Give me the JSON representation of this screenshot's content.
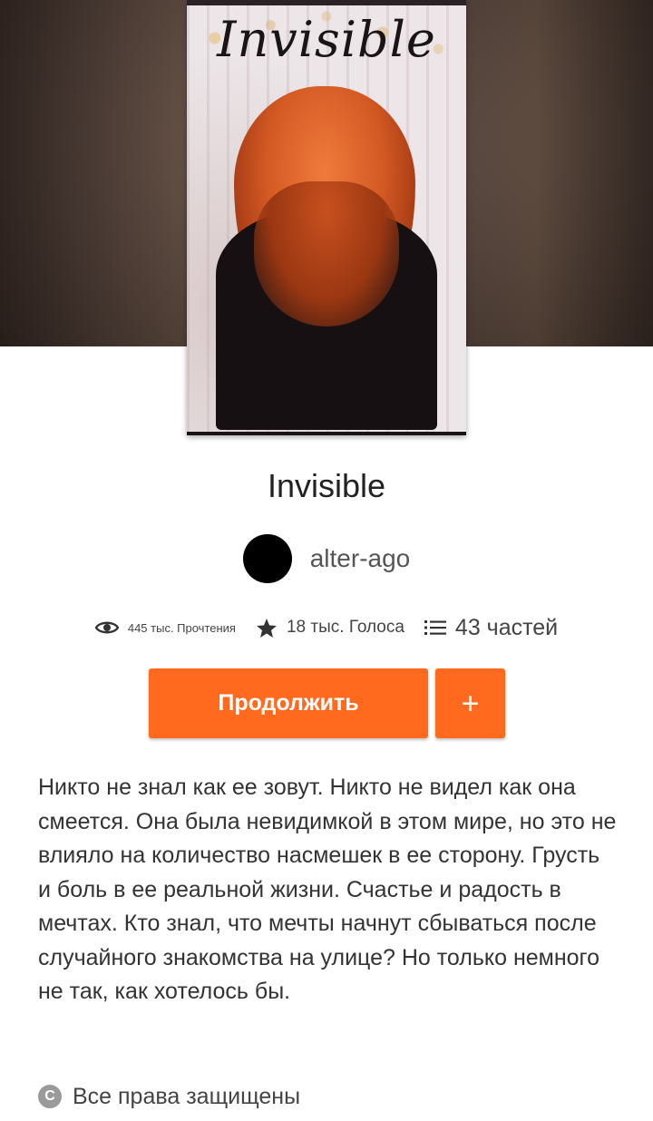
{
  "cover": {
    "title_art": "Invisible"
  },
  "story": {
    "title": "Invisible",
    "author": "alter-ago"
  },
  "stats": {
    "reads": "445 тыс. Прочтения",
    "votes": "18 тыс. Голоса",
    "parts": "43 частей"
  },
  "actions": {
    "continue_label": "Продолжить",
    "add_label": "+"
  },
  "description": "Никто не знал как ее зовут. Никто не видел как она смеется. Она была невидимкой в этом мире, но это не влияло на количество насмешек в ее сторону. Грусть и боль в ее реальной жизни. Счастье и радость в мечтах. Кто знал, что мечты начнут сбываться после случайного знакомства на улице? Но только немного не так, как хотелось бы.",
  "footer": {
    "rights": "Все права защищены",
    "rights_icon": "copyright-icon"
  },
  "colors": {
    "accent": "#ff6a1f"
  }
}
